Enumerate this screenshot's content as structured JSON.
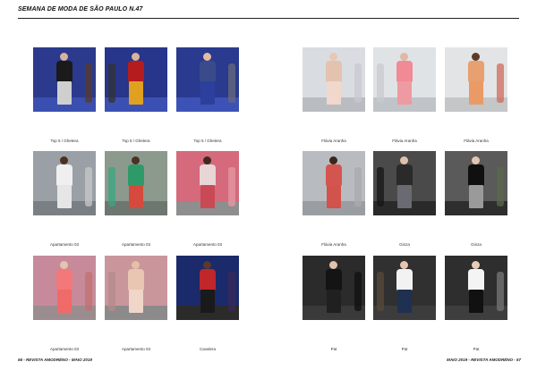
{
  "header": {
    "title": "SEMANA DE MODA DE SÃO PAULO N.47"
  },
  "footer": {
    "left": "56 - REVISTA AMODRÉNO - MAIO 2019",
    "right": "MAIO 2019 - REVISTA AMODRÉNO - 57"
  },
  "left_page": {
    "rows": [
      {
        "captions": [
          "Top 5 / Ghetera",
          "Top 5 / Ghetera",
          "Top 5 / Ghetera"
        ]
      },
      {
        "captions": [
          "Apartamento 03",
          "Apartamento 03",
          "Apartamento 03"
        ]
      },
      {
        "captions": [
          "Apartamento 03",
          "Apartamento 03",
          "Cavalera"
        ]
      }
    ]
  },
  "right_page": {
    "rows": [
      {
        "captions": [
          "Flávia Aranha",
          "Flávia Aranha",
          "Flávia Aranha"
        ]
      },
      {
        "captions": [
          "Flávia Aranha",
          "Ginza",
          "Ginza"
        ]
      },
      {
        "captions": [
          "Pat",
          "Pat",
          "Pat"
        ]
      }
    ]
  },
  "photos": [
    {
      "bg": "#2b3a8c",
      "floor": "#3b4fb0",
      "skin": "#d9b39a",
      "top": "#1a1a1a",
      "bottom": "#cfcfcf",
      "side": "#5a3a2a"
    },
    {
      "bg": "#27358a",
      "floor": "#3c50b4",
      "skin": "#d8b59c",
      "top": "#b51c1c",
      "bottom": "#e0a020",
      "side": "#333333"
    },
    {
      "bg": "#2a3a8e",
      "floor": "#3d52b6",
      "skin": "#e0bda4",
      "top": "#3a4a8a",
      "bottom": "#2d3f9c",
      "side": "#6a6a7a"
    },
    {
      "bg": "#9aa0a6",
      "floor": "#7a7f84",
      "skin": "#4a2f22",
      "top": "#efefef",
      "bottom": "#e6e6e6",
      "side": "#c8c8c8"
    },
    {
      "bg": "#8c9a8e",
      "floor": "#6e7670",
      "skin": "#4d3122",
      "top": "#2e9a6a",
      "bottom": "#d54a3c",
      "side": "#3aa580"
    },
    {
      "bg": "#d46a7c",
      "floor": "#8e8e8e",
      "skin": "#3f281c",
      "top": "#e8d6d6",
      "bottom": "#c94a55",
      "side": "#e59aa4"
    },
    {
      "bg": "#c78a9a",
      "floor": "#9b8d8f",
      "skin": "#e6c3ad",
      "top": "#f2787a",
      "bottom": "#f06a68",
      "side": "#c07070"
    },
    {
      "bg": "#c9969c",
      "floor": "#8c8a8a",
      "skin": "#e5c0a6",
      "top": "#e9c6b2",
      "bottom": "#efd6c8",
      "side": "#b48a8a"
    },
    {
      "bg": "#1b2a6a",
      "floor": "#2b2b2b",
      "skin": "#5a3a28",
      "top": "#c0262a",
      "bottom": "#1a1a1a",
      "side": "#3a2a5a"
    },
    {
      "bg": "#d9dde2",
      "floor": "#b9bdc2",
      "skin": "#e8c8b4",
      "top": "#e3c2b0",
      "bottom": "#f1d7cc",
      "side": "#c8c8d0"
    },
    {
      "bg": "#dfe3e6",
      "floor": "#c0c4c8",
      "skin": "#e0b8a4",
      "top": "#f08a94",
      "bottom": "#ee9aa2",
      "side": "#c8cacd"
    },
    {
      "bg": "#e2e4e6",
      "floor": "#c4c6c8",
      "skin": "#5e3a26",
      "top": "#e8a070",
      "bottom": "#ea9a64",
      "side": "#d06a5a"
    },
    {
      "bg": "#b8bcc0",
      "floor": "#9a9ea2",
      "skin": "#3a261c",
      "top": "#d4554f",
      "bottom": "#d2524c",
      "side": "#a8aaae"
    },
    {
      "bg": "#4a4a4a",
      "floor": "#2a2a2a",
      "skin": "#e0c0aa",
      "top": "#2a2a2a",
      "bottom": "#6a6a72",
      "side": "#151515"
    },
    {
      "bg": "#5a5a5a",
      "floor": "#2e2e2e",
      "skin": "#e4c6b2",
      "top": "#101010",
      "bottom": "#9a9a9a",
      "side": "#5a6a4a"
    },
    {
      "bg": "#2b2b2b",
      "floor": "#3a3a3a",
      "skin": "#e2c2ae",
      "top": "#141414",
      "bottom": "#202020",
      "side": "#101010"
    },
    {
      "bg": "#303030",
      "floor": "#3c3c3c",
      "skin": "#e6c6b0",
      "top": "#f2f2f2",
      "bottom": "#1f3050",
      "side": "#5a4a3a"
    },
    {
      "bg": "#2e2e2e",
      "floor": "#3e3e3e",
      "skin": "#e8ccb8",
      "top": "#f4f4f4",
      "bottom": "#111111",
      "side": "#777777"
    }
  ]
}
